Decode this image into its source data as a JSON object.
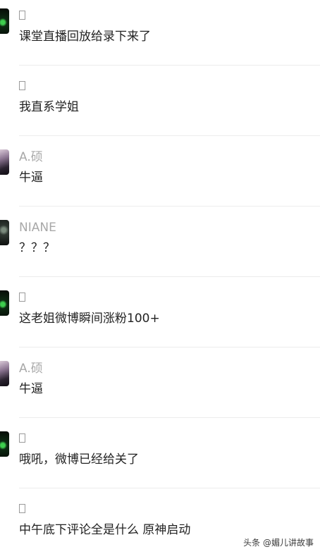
{
  "comments": [
    {
      "username": "",
      "content": "课堂直播回放给录下来了",
      "avatar_icon": "green-mask-avatar"
    },
    {
      "username": "",
      "content": "我直系学姐",
      "avatar_icon": "none"
    },
    {
      "username": "A.硕",
      "content": "牛逼",
      "avatar_icon": "portrait-avatar"
    },
    {
      "username": "NIANE",
      "content": "？？？",
      "avatar_icon": "dark-portrait-avatar"
    },
    {
      "username": "",
      "content": "这老姐微博瞬间涨粉100+",
      "avatar_icon": "green-mask-avatar"
    },
    {
      "username": "A.硕",
      "content": "牛逼",
      "avatar_icon": "portrait-avatar"
    },
    {
      "username": "",
      "content": "哦吼，微博已经给关了",
      "avatar_icon": "green-mask-avatar"
    },
    {
      "username": "",
      "content": "中午底下评论全是什么  原神启动",
      "avatar_icon": "none"
    }
  ],
  "watermark": "头条 @媚儿讲故事",
  "colors": {
    "username": "#a8a8a8",
    "content": "#222222",
    "divider": "#ececec"
  }
}
